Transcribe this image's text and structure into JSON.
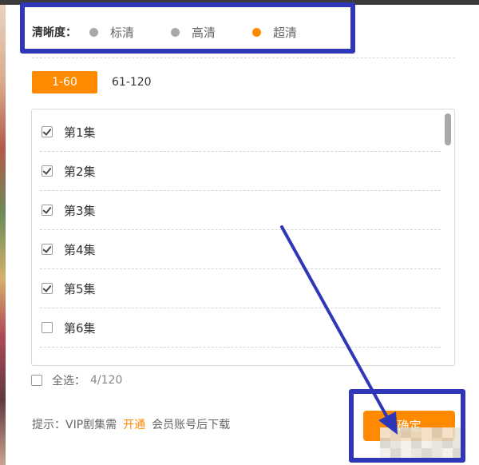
{
  "quality": {
    "label": "清晰度：",
    "options": [
      {
        "label": "标清",
        "selected": false
      },
      {
        "label": "高清",
        "selected": false
      },
      {
        "label": "超清",
        "selected": true
      }
    ]
  },
  "range_tabs": [
    {
      "label": "1-60",
      "active": true
    },
    {
      "label": "61-120",
      "active": false
    }
  ],
  "episodes": [
    {
      "label": "第1集",
      "checked": true
    },
    {
      "label": "第2集",
      "checked": true
    },
    {
      "label": "第3集",
      "checked": true
    },
    {
      "label": "第4集",
      "checked": true
    },
    {
      "label": "第5集",
      "checked": true
    },
    {
      "label": "第6集",
      "checked": false
    }
  ],
  "select_all": {
    "label": "全选：",
    "count": "4/120",
    "checked": false
  },
  "hint": {
    "prefix": "提示：VIP剧集需",
    "link": "开通",
    "suffix": "会员账号后下载"
  },
  "download_button": {
    "label": "确定"
  },
  "colors": {
    "accent": "#ff8a00",
    "annotation": "#2f37b8",
    "radio_unselected": "#a9a9a9"
  }
}
